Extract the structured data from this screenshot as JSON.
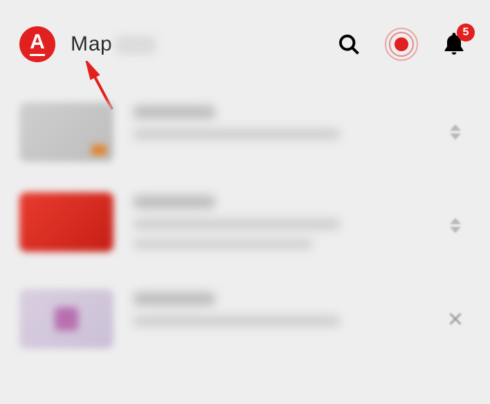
{
  "header": {
    "logo_letter": "A",
    "title": "Мар",
    "notification_count": "5"
  },
  "icons": {
    "search": "search-icon",
    "record": "record-icon",
    "bell": "bell-icon",
    "sort": "sort-icon",
    "close": "close-icon"
  }
}
